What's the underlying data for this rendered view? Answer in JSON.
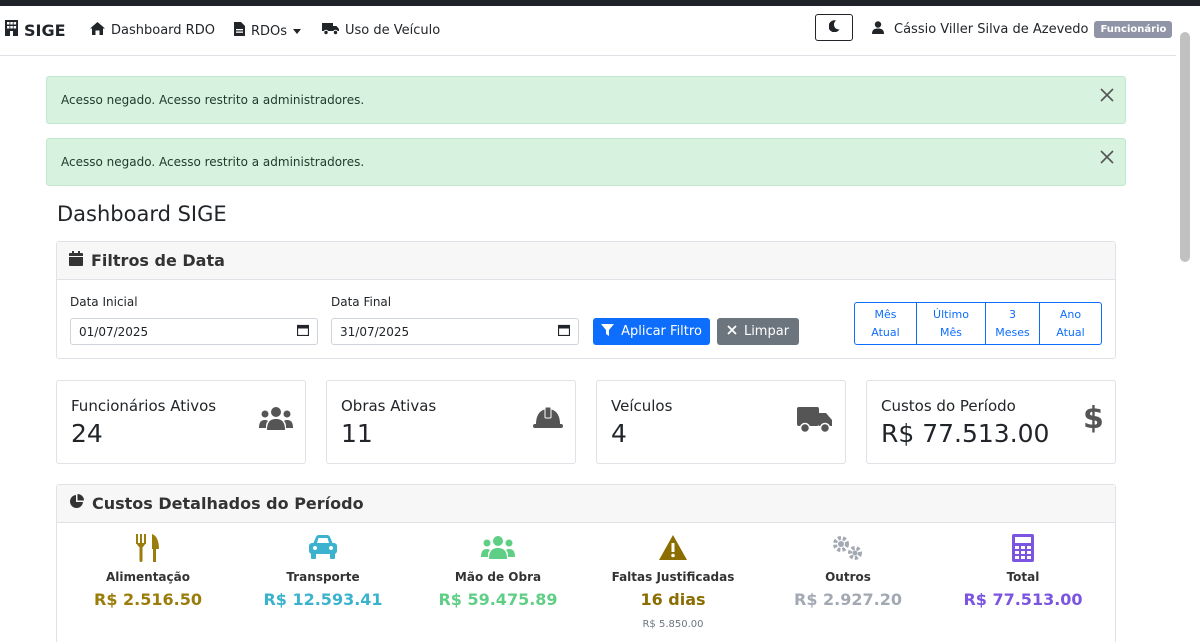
{
  "nav": {
    "brand": "SIGE",
    "items": [
      {
        "label": "Dashboard RDO",
        "icon": "home-icon"
      },
      {
        "label": "RDOs",
        "icon": "file-icon",
        "dropdown": true
      },
      {
        "label": "Uso de Veículo",
        "icon": "truck-icon"
      }
    ],
    "theme_toggle_icon": "moon-icon",
    "user_name": "Cássio Viller Silva de Azevedo",
    "user_role": "Funcionário"
  },
  "alerts": [
    {
      "text": "Acesso negado. Acesso restrito a administradores."
    },
    {
      "text": "Acesso negado. Acesso restrito a administradores."
    }
  ],
  "page_title": "Dashboard SIGE",
  "filters": {
    "title": "Filtros de Data",
    "start_label": "Data Inicial",
    "start_value": "01/07/2025",
    "end_label": "Data Final",
    "end_value": "31/07/2025",
    "apply_label": "Aplicar Filtro",
    "clear_label": "Limpar",
    "presets": [
      {
        "line1": "Mês",
        "line2": "Atual"
      },
      {
        "line1": "Último",
        "line2": "Mês"
      },
      {
        "line1": "3",
        "line2": "Meses"
      },
      {
        "line1": "Ano",
        "line2": "Atual"
      }
    ]
  },
  "stats": [
    {
      "label": "Funcionários Ativos",
      "value": "24",
      "icon": "users-icon"
    },
    {
      "label": "Obras Ativas",
      "value": "11",
      "icon": "hardhat-icon"
    },
    {
      "label": "Veículos",
      "value": "4",
      "icon": "truck-icon"
    },
    {
      "label": "Custos do Período",
      "value": "R$ 77.513.00",
      "icon": "dollar-icon"
    }
  ],
  "costs": {
    "title": "Custos Detalhados do Período",
    "items": [
      {
        "label": "Alimentação",
        "value": "R$ 2.516.50",
        "color": "#9a7d0a",
        "icon": "utensils-icon"
      },
      {
        "label": "Transporte",
        "value": "R$ 12.593.41",
        "color": "#3bb3cf",
        "icon": "car-icon"
      },
      {
        "label": "Mão de Obra",
        "value": "R$ 59.475.89",
        "color": "#5fcf86",
        "icon": "users-icon"
      },
      {
        "label": "Faltas Justificadas",
        "value": "16 dias",
        "sub": "R$ 5.850.00",
        "color": "#8c6d00",
        "icon": "warning-icon"
      },
      {
        "label": "Outros",
        "value": "R$ 2.927.20",
        "color": "#a3a9b3",
        "icon": "gears-icon"
      },
      {
        "label": "Total",
        "value": "R$ 77.513.00",
        "color": "#7b55e0",
        "icon": "calculator-icon"
      }
    ]
  }
}
